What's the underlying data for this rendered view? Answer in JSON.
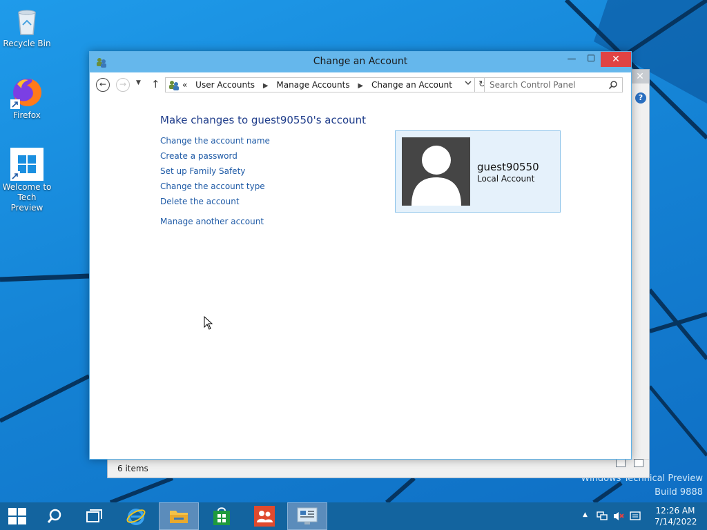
{
  "desktop": {
    "icons": [
      {
        "label": "Recycle Bin"
      },
      {
        "label": "Firefox"
      },
      {
        "label_line1": "Welcome to",
        "label_line2": "Tech Preview"
      }
    ],
    "watermark_line1": "Windows Technical Preview",
    "watermark_line2": "Build 9888"
  },
  "bg_window": {
    "status_text": "6 items",
    "close_glyph": "✕",
    "help_glyph": "?"
  },
  "window": {
    "title": "Change an Account",
    "controls": {
      "minimize": "—",
      "maximize": "☐",
      "close": "✕"
    }
  },
  "navigation": {
    "back_glyph": "←",
    "forward_glyph": "→",
    "recent_glyph": "▼",
    "up_glyph": "↑",
    "overflow": "«",
    "breadcrumbs": [
      "User Accounts",
      "Manage Accounts",
      "Change an Account"
    ],
    "separator": "▶",
    "refresh_glyph": "↻",
    "search_placeholder": "Search Control Panel"
  },
  "content": {
    "heading": "Make changes to guest90550's account",
    "tasks": [
      "Change the account name",
      "Create a password",
      "Set up Family Safety",
      "Change the account type",
      "Delete the account"
    ],
    "other_task": "Manage another account",
    "account": {
      "name": "guest90550",
      "type": "Local Account"
    }
  },
  "taskbar": {
    "apps": [
      "start",
      "search",
      "task-view",
      "internet-explorer",
      "file-explorer",
      "store",
      "user-accounts",
      "control-panel"
    ],
    "time": "12:26 AM",
    "date": "7/14/2022",
    "tray_overflow": "▲"
  },
  "colors": {
    "accent": "#65b7ec",
    "link": "#1e5aa6",
    "heading": "#1e3c8a",
    "taskbar": "#13649f"
  }
}
